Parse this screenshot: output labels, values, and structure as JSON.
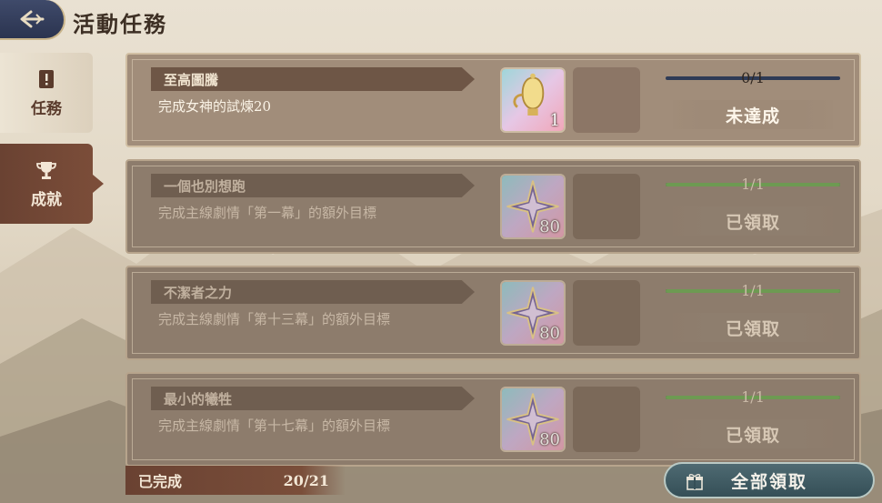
{
  "header": {
    "back_icon": "back-arrow-icon",
    "title": "活動任務"
  },
  "sidebar": {
    "tabs": [
      {
        "label": "任務",
        "icon": "exclamation-scroll-icon",
        "selected": false
      },
      {
        "label": "成就",
        "icon": "trophy-icon",
        "selected": true
      }
    ]
  },
  "quests": [
    {
      "title": "至高圖騰",
      "description": "完成女神的試煉20",
      "reward_icon": "golden-lantern-icon",
      "reward_qty": "1",
      "progress_text": "0/1",
      "progress_fraction": 0,
      "status": "未達成",
      "completed": false
    },
    {
      "title": "一個也別想跑",
      "description": "完成主線劇情「第一幕」的額外目標",
      "reward_icon": "star-crystal-icon",
      "reward_qty": "80",
      "progress_text": "1/1",
      "progress_fraction": 1,
      "status": "已領取",
      "completed": true
    },
    {
      "title": "不潔者之力",
      "description": "完成主線劇情「第十三幕」的額外目標",
      "reward_icon": "star-crystal-icon",
      "reward_qty": "80",
      "progress_text": "1/1",
      "progress_fraction": 1,
      "status": "已領取",
      "completed": true
    },
    {
      "title": "最小的犧牲",
      "description": "完成主線劇情「第十七幕」的額外目標",
      "reward_icon": "star-crystal-icon",
      "reward_qty": "80",
      "progress_text": "1/1",
      "progress_fraction": 1,
      "status": "已領取",
      "completed": true
    }
  ],
  "footer": {
    "completed_label": "已完成",
    "completed_count": "20/21",
    "claim_all_label": "全部領取",
    "claim_all_icon": "gift-icon"
  },
  "colors": {
    "progress_fill": "#6d9a52",
    "progress_track": "#2f3b56",
    "tab_selected": "#6a4232",
    "claim_button": "#3f5d65"
  }
}
